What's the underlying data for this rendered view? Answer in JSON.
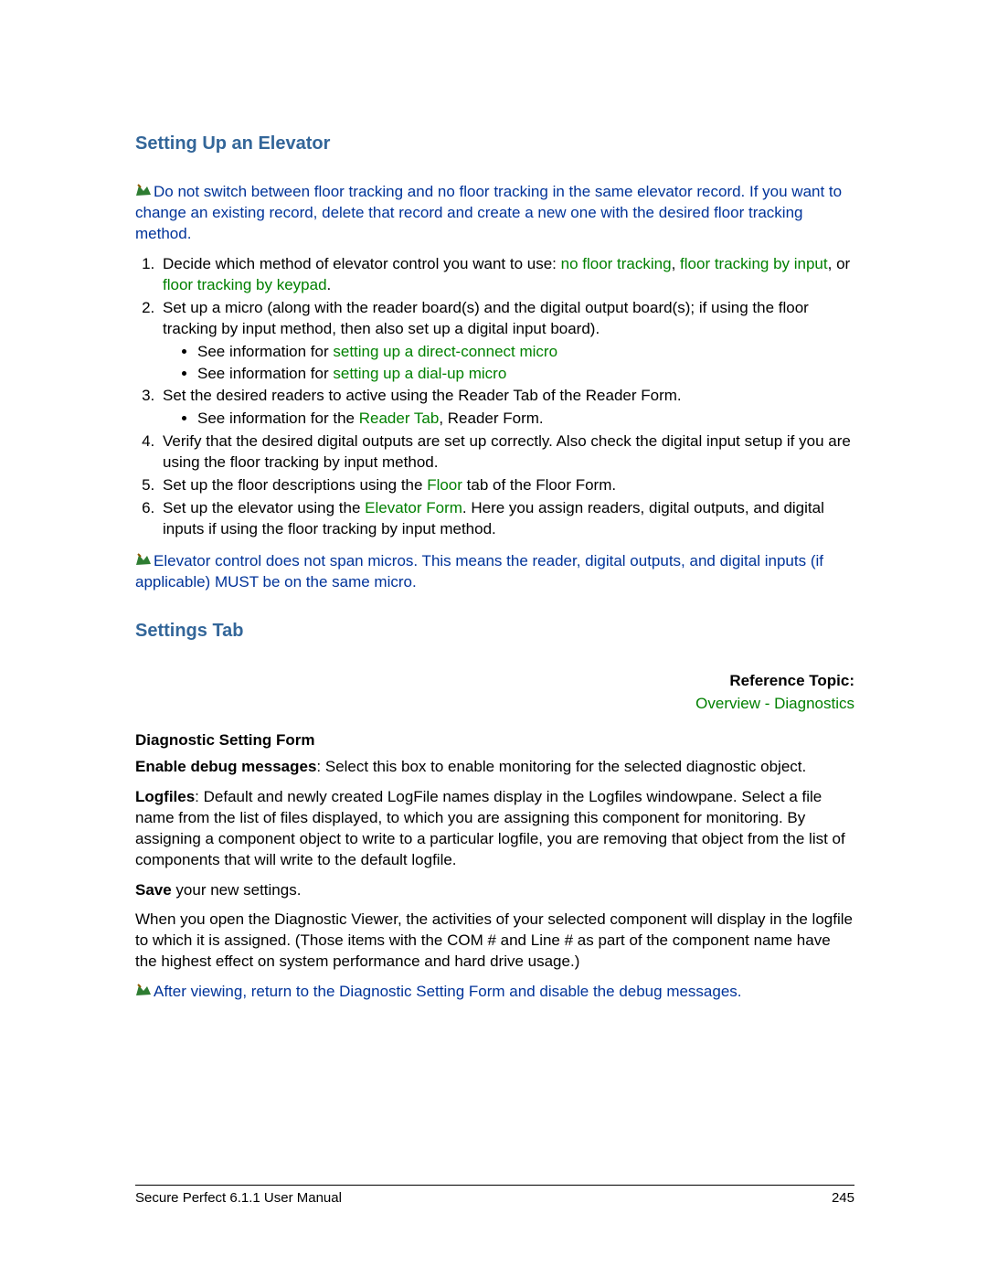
{
  "section1": {
    "heading": "Setting Up an Elevator",
    "note1_a": "Do not switch between floor tracking and no floor tracking in the same elevator record. If you want to change an existing record, delete that record and create a new one with the desired floor tracking method.",
    "step1_a": "Decide which method of elevator control you want to use: ",
    "step1_link1": "no floor tracking",
    "step1_b": ", ",
    "step1_link2": "floor tracking by input",
    "step1_c": ", or ",
    "step1_link3": "floor tracking by keypad",
    "step1_d": ".",
    "step2": "Set up a micro (along with the reader board(s) and the digital output board(s); if using the floor tracking by input method, then also set up a digital input board).",
    "step2_b1_a": "See information for ",
    "step2_b1_link": "setting up a direct-connect micro",
    "step2_b2_a": "See information for ",
    "step2_b2_link": "setting up a dial-up micro",
    "step3": "Set the desired readers to active using the Reader Tab of the Reader Form.",
    "step3_b1_a": "See information for the ",
    "step3_b1_link": "Reader Tab",
    "step3_b1_b": ", Reader Form.",
    "step4": "Verify that the desired digital outputs are set up correctly. Also check the digital input setup if you are using the floor tracking by input method.",
    "step5_a": "Set up the floor descriptions using the ",
    "step5_link": "Floor",
    "step5_b": " tab of the Floor Form.",
    "step6_a": "Set up the elevator using the ",
    "step6_link": "Elevator Form",
    "step6_b": ". Here you assign readers, digital outputs, and digital inputs if using the floor tracking by input method.",
    "note2": "Elevator control does not span micros. This means the reader, digital outputs, and digital inputs (if applicable) MUST be on the same micro."
  },
  "section2": {
    "heading": "Settings Tab",
    "ref_label": "Reference Topic:",
    "ref_link": "Overview - Diagnostics",
    "subhead": "Diagnostic Setting Form",
    "p1_bold": "Enable debug messages",
    "p1_rest": ": Select this box to enable monitoring for the selected diagnostic object.",
    "p2_bold": "Logfiles",
    "p2_rest": ": Default and newly created LogFile names display in the Logfiles windowpane. Select a file name from the list of files displayed, to which you are assigning this component for monitoring. By assigning a component object to write to a particular logfile, you are removing that object from the list of components that will write to the default logfile.",
    "p3_bold": "Save",
    "p3_rest": " your new settings.",
    "p4": "When you open the Diagnostic Viewer, the activities of your selected component will display in the logfile to which it is assigned. (Those items with the COM # and Line # as part of the component name have the highest effect on system performance and hard drive usage.)",
    "note3": "After viewing, return to the Diagnostic Setting Form and disable the debug messages."
  },
  "footer": {
    "left": "Secure Perfect 6.1.1 User Manual",
    "right": "245"
  }
}
